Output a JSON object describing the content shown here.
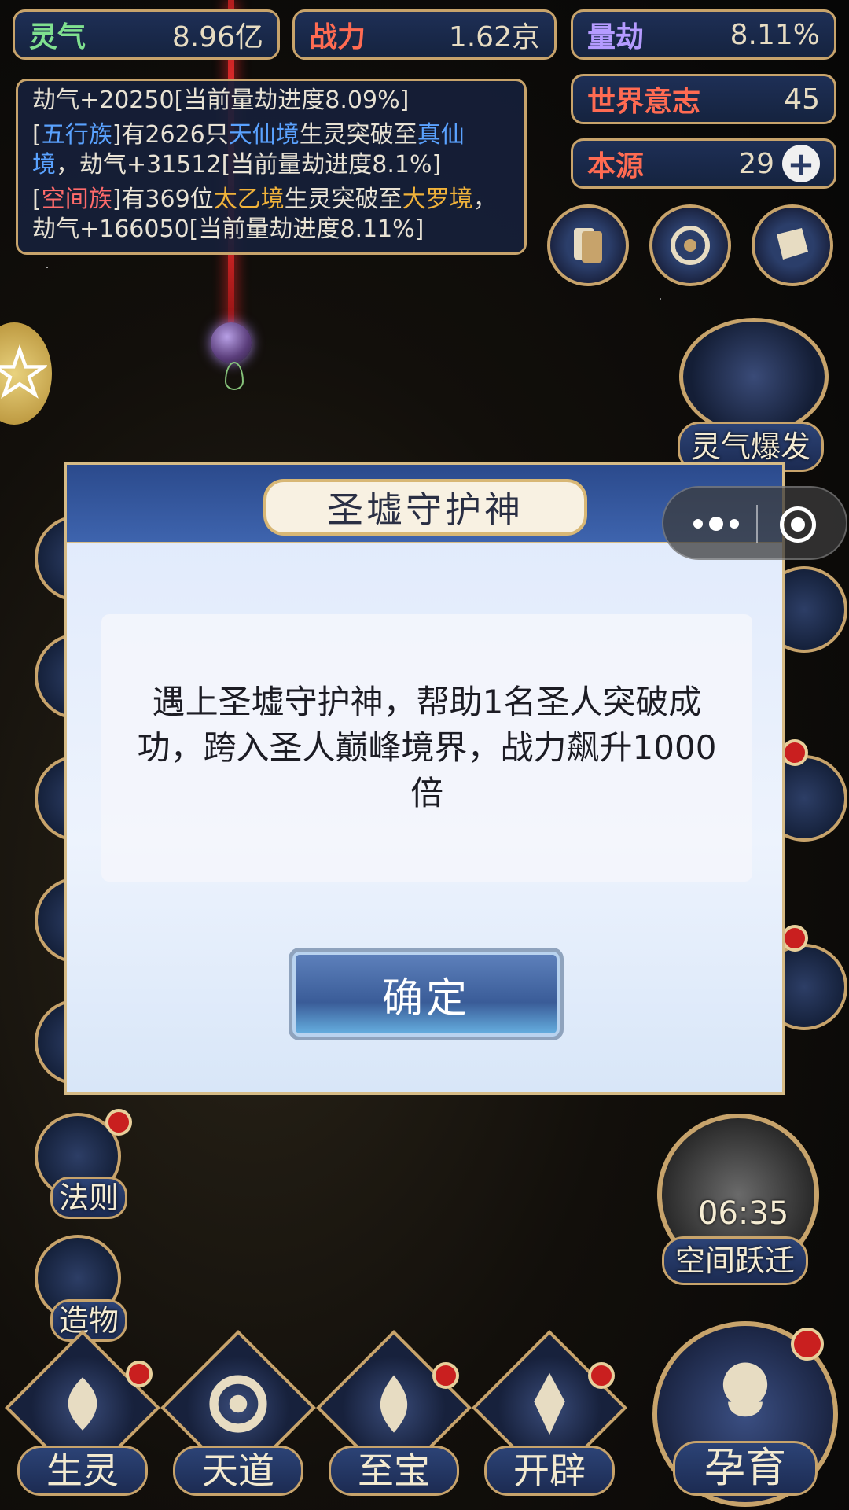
{
  "resources": {
    "lingqi": {
      "label": "灵气",
      "value": "8.96亿"
    },
    "zhanli": {
      "label": "战力",
      "value": "1.62京"
    },
    "liangjie": {
      "label": "量劫",
      "value": "8.11%"
    },
    "world_will": {
      "label": "世界意志",
      "value": "45"
    },
    "benyuan": {
      "label": "本源",
      "value": "29"
    }
  },
  "log": {
    "line1": "劫气+20250[当前量劫进度8.09%]",
    "line2": {
      "p1": "[",
      "race": "五行族",
      "p2": "]有2626只",
      "realm_from": "天仙境",
      "p3": "生灵突破至",
      "realm_to": "真仙境",
      "p4": "，劫气+31512[当前量劫进度8.1%]"
    },
    "line3": {
      "p1": "[",
      "race": "空间族",
      "p2": "]有369位",
      "realm_from": "太乙境",
      "p3": "生灵突破至",
      "realm_to": "大罗境",
      "p4": "，劫气+166050[当前量劫进度8.11%]"
    }
  },
  "right_panel": {
    "burst_label": "灵气爆发",
    "jump_label": "空间跃迁",
    "timer": "06:35"
  },
  "left_side": {
    "law_label": "法则",
    "creation_label": "造物"
  },
  "bottom_nav": {
    "items": [
      {
        "label": "生灵"
      },
      {
        "label": "天道"
      },
      {
        "label": "至宝"
      },
      {
        "label": "开辟"
      }
    ],
    "main_label": "孕育"
  },
  "dialog": {
    "title": "圣墟守护神",
    "message": "遇上圣墟守护神，帮助1名圣人突破成功，跨入圣人巅峰境界，战力飙升1000倍",
    "confirm": "确定"
  },
  "colors": {
    "gold_border": "#c7a36b",
    "panel_blue": "#1e2f56",
    "race_blue": "#5aa2ff",
    "race_red": "#ff6b6b",
    "realm_gold": "#f0b23a",
    "badge_red": "#c91f1f"
  },
  "icons": [
    "cards-icon",
    "portal-icon",
    "scroll-icon",
    "star-badge-icon",
    "plus-icon",
    "more-dots-icon",
    "target-icon"
  ]
}
